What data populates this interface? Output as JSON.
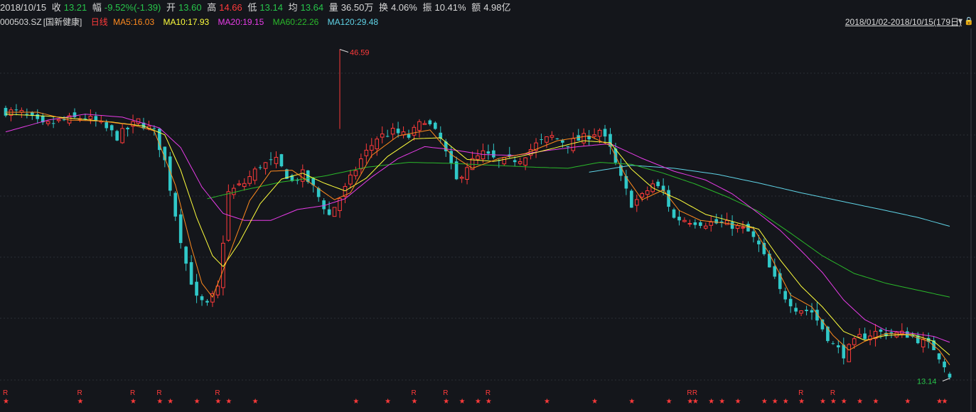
{
  "stats": {
    "date": "2018/10/15",
    "close_label": "收",
    "close": "13.21",
    "change_label": "幅",
    "change": "-9.52%(-1.39)",
    "open_label": "开",
    "open": "13.60",
    "high_label": "高",
    "high": "14.66",
    "low_label": "低",
    "low": "13.14",
    "avg_label": "均",
    "avg": "13.64",
    "volume_label": "量",
    "volume": "36.50万",
    "turnover_label": "换",
    "turnover": "4.06%",
    "amplitude_label": "振",
    "amplitude": "10.41%",
    "amount_label": "额",
    "amount": "4.98亿"
  },
  "legend": {
    "code": "000503.SZ",
    "name": "[国新健康]",
    "period": "日线",
    "ma5": "MA5:16.03",
    "ma10": "MA10:17.93",
    "ma20": "MA20:19.15",
    "ma60": "MA60:22.26",
    "ma120": "MA120:29.48"
  },
  "range_label": "2018/01/02-2018/10/15(179日)",
  "colors": {
    "up": "#ff3a3a",
    "down": "#30c8c8",
    "ma5": "#ff8a1e",
    "ma10": "#ffff3c",
    "ma20": "#e83ce8",
    "ma60": "#2ab82a",
    "ma120": "#5fd3e6",
    "grid": "#2a2d34"
  },
  "chart_data": {
    "type": "candlestick",
    "x_range": [
      "2018/01/02",
      "2018/10/15"
    ],
    "bar_count": 179,
    "price_range": [
      12.6,
      48.0
    ],
    "max_annotation": "46.59",
    "min_annotation": "13.14",
    "close_path": [
      [
        0,
        40.3
      ],
      [
        3,
        40.1
      ],
      [
        7,
        38.8
      ],
      [
        11,
        39.4
      ],
      [
        15,
        39.7
      ],
      [
        18,
        38.9
      ],
      [
        21,
        37.7
      ],
      [
        25,
        39.3
      ],
      [
        28,
        38.2
      ],
      [
        30,
        35.2
      ],
      [
        32,
        29.8
      ],
      [
        34,
        24.8
      ],
      [
        36,
        21.2
      ],
      [
        38,
        20.5
      ],
      [
        40,
        22.3
      ],
      [
        42,
        32.0
      ],
      [
        45,
        33.0
      ],
      [
        48,
        34.8
      ],
      [
        51,
        35.2
      ],
      [
        54,
        33.1
      ],
      [
        56,
        33.9
      ],
      [
        58,
        32.5
      ],
      [
        61,
        29.7
      ],
      [
        64,
        32.4
      ],
      [
        67,
        35.4
      ],
      [
        70,
        37.6
      ],
      [
        73,
        38.2
      ],
      [
        76,
        37.7
      ],
      [
        79,
        39.5
      ],
      [
        82,
        37.4
      ],
      [
        85,
        33.2
      ],
      [
        87,
        34.8
      ],
      [
        90,
        36.0
      ],
      [
        93,
        35.1
      ],
      [
        97,
        35.5
      ],
      [
        100,
        36.9
      ],
      [
        103,
        37.7
      ],
      [
        106,
        37.0
      ],
      [
        109,
        37.6
      ],
      [
        112,
        38.4
      ],
      [
        114,
        36.4
      ],
      [
        116,
        33.4
      ],
      [
        118,
        30.9
      ],
      [
        120,
        31.6
      ],
      [
        122,
        32.9
      ],
      [
        124,
        32.1
      ],
      [
        126,
        29.4
      ],
      [
        128,
        29.3
      ],
      [
        131,
        29.0
      ],
      [
        134,
        28.9
      ],
      [
        137,
        28.7
      ],
      [
        140,
        28.0
      ],
      [
        142,
        26.6
      ],
      [
        144,
        24.3
      ],
      [
        146,
        22.0
      ],
      [
        149,
        20.3
      ],
      [
        152,
        19.9
      ],
      [
        154,
        18.2
      ],
      [
        156,
        16.5
      ],
      [
        158,
        15.6
      ],
      [
        161,
        17.3
      ],
      [
        164,
        17.8
      ],
      [
        167,
        17.7
      ],
      [
        170,
        17.6
      ],
      [
        172,
        17.1
      ],
      [
        175,
        16.2
      ],
      [
        176,
        15.4
      ],
      [
        177,
        14.6
      ],
      [
        178,
        13.21
      ]
    ],
    "ma5_path": [
      [
        0,
        40.2
      ],
      [
        6,
        40.2
      ],
      [
        12,
        39.4
      ],
      [
        18,
        39.3
      ],
      [
        24,
        38.9
      ],
      [
        28,
        38.3
      ],
      [
        32,
        32.8
      ],
      [
        35,
        26.5
      ],
      [
        37,
        22.8
      ],
      [
        39,
        21.4
      ],
      [
        42,
        25.5
      ],
      [
        46,
        31.2
      ],
      [
        50,
        34.2
      ],
      [
        54,
        34.3
      ],
      [
        58,
        32.8
      ],
      [
        62,
        31.3
      ],
      [
        65,
        32.0
      ],
      [
        69,
        35.8
      ],
      [
        74,
        37.8
      ],
      [
        80,
        38.4
      ],
      [
        84,
        35.9
      ],
      [
        88,
        34.5
      ],
      [
        93,
        35.5
      ],
      [
        98,
        36.0
      ],
      [
        104,
        37.3
      ],
      [
        110,
        37.8
      ],
      [
        114,
        36.8
      ],
      [
        117,
        33.6
      ],
      [
        120,
        31.3
      ],
      [
        124,
        32.3
      ],
      [
        127,
        30.2
      ],
      [
        131,
        29.2
      ],
      [
        136,
        28.9
      ],
      [
        141,
        28.4
      ],
      [
        144,
        25.8
      ],
      [
        148,
        21.6
      ],
      [
        152,
        20.4
      ],
      [
        156,
        17.5
      ],
      [
        159,
        16.0
      ],
      [
        162,
        16.9
      ],
      [
        166,
        17.7
      ],
      [
        170,
        17.6
      ],
      [
        174,
        16.9
      ],
      [
        176,
        16.0
      ],
      [
        178,
        14.5
      ]
    ],
    "ma10_path": [
      [
        0,
        40.0
      ],
      [
        8,
        39.8
      ],
      [
        14,
        39.5
      ],
      [
        20,
        39.2
      ],
      [
        26,
        38.8
      ],
      [
        30,
        37.9
      ],
      [
        33,
        34.3
      ],
      [
        36,
        29.5
      ],
      [
        39,
        25.6
      ],
      [
        41,
        24.5
      ],
      [
        44,
        26.9
      ],
      [
        48,
        30.9
      ],
      [
        52,
        33.4
      ],
      [
        56,
        34.0
      ],
      [
        60,
        33.0
      ],
      [
        64,
        32.2
      ],
      [
        68,
        33.5
      ],
      [
        72,
        35.7
      ],
      [
        77,
        37.5
      ],
      [
        82,
        37.6
      ],
      [
        87,
        35.4
      ],
      [
        92,
        35.2
      ],
      [
        97,
        35.7
      ],
      [
        103,
        36.5
      ],
      [
        109,
        37.3
      ],
      [
        114,
        37.1
      ],
      [
        118,
        34.4
      ],
      [
        122,
        32.5
      ],
      [
        127,
        31.3
      ],
      [
        132,
        29.8
      ],
      [
        137,
        29.1
      ],
      [
        142,
        28.3
      ],
      [
        146,
        25.2
      ],
      [
        150,
        22.5
      ],
      [
        154,
        20.4
      ],
      [
        158,
        17.9
      ],
      [
        162,
        17.0
      ],
      [
        166,
        17.5
      ],
      [
        171,
        17.6
      ],
      [
        175,
        16.9
      ],
      [
        178,
        15.5
      ]
    ],
    "ma20_path": [
      [
        0,
        38.2
      ],
      [
        8,
        39.4
      ],
      [
        15,
        40.0
      ],
      [
        22,
        39.7
      ],
      [
        29,
        38.6
      ],
      [
        33,
        36.6
      ],
      [
        37,
        32.6
      ],
      [
        41,
        29.9
      ],
      [
        45,
        29.2
      ],
      [
        50,
        29.2
      ],
      [
        55,
        30.3
      ],
      [
        60,
        30.7
      ],
      [
        64,
        31.4
      ],
      [
        69,
        33.6
      ],
      [
        74,
        35.5
      ],
      [
        79,
        36.7
      ],
      [
        84,
        36.4
      ],
      [
        90,
        35.9
      ],
      [
        96,
        35.8
      ],
      [
        102,
        36.3
      ],
      [
        108,
        36.7
      ],
      [
        114,
        37.0
      ],
      [
        120,
        35.5
      ],
      [
        126,
        34.2
      ],
      [
        132,
        33.3
      ],
      [
        137,
        31.9
      ],
      [
        142,
        29.9
      ],
      [
        146,
        28.2
      ],
      [
        150,
        26.1
      ],
      [
        154,
        23.9
      ],
      [
        158,
        21.1
      ],
      [
        162,
        19.1
      ],
      [
        166,
        18.0
      ],
      [
        171,
        17.7
      ],
      [
        175,
        17.4
      ],
      [
        178,
        16.8
      ]
    ],
    "ma60_path": [
      [
        38,
        31.4
      ],
      [
        45,
        32.3
      ],
      [
        52,
        33.1
      ],
      [
        60,
        33.7
      ],
      [
        68,
        34.6
      ],
      [
        76,
        35.1
      ],
      [
        84,
        35.0
      ],
      [
        92,
        34.8
      ],
      [
        100,
        34.6
      ],
      [
        106,
        34.5
      ],
      [
        112,
        35.1
      ],
      [
        118,
        34.9
      ],
      [
        124,
        34.0
      ],
      [
        130,
        32.9
      ],
      [
        136,
        31.6
      ],
      [
        142,
        30.1
      ],
      [
        148,
        27.9
      ],
      [
        154,
        25.6
      ],
      [
        160,
        23.8
      ],
      [
        166,
        22.8
      ],
      [
        172,
        22.1
      ],
      [
        178,
        21.4
      ]
    ],
    "ma120_path": [
      [
        110,
        34.1
      ],
      [
        118,
        34.8
      ],
      [
        126,
        34.5
      ],
      [
        134,
        33.9
      ],
      [
        142,
        33.0
      ],
      [
        150,
        32.0
      ],
      [
        158,
        31.1
      ],
      [
        166,
        30.2
      ],
      [
        172,
        29.5
      ],
      [
        178,
        28.6
      ]
    ],
    "signal_markers": "R / ★ markers along bottom"
  }
}
